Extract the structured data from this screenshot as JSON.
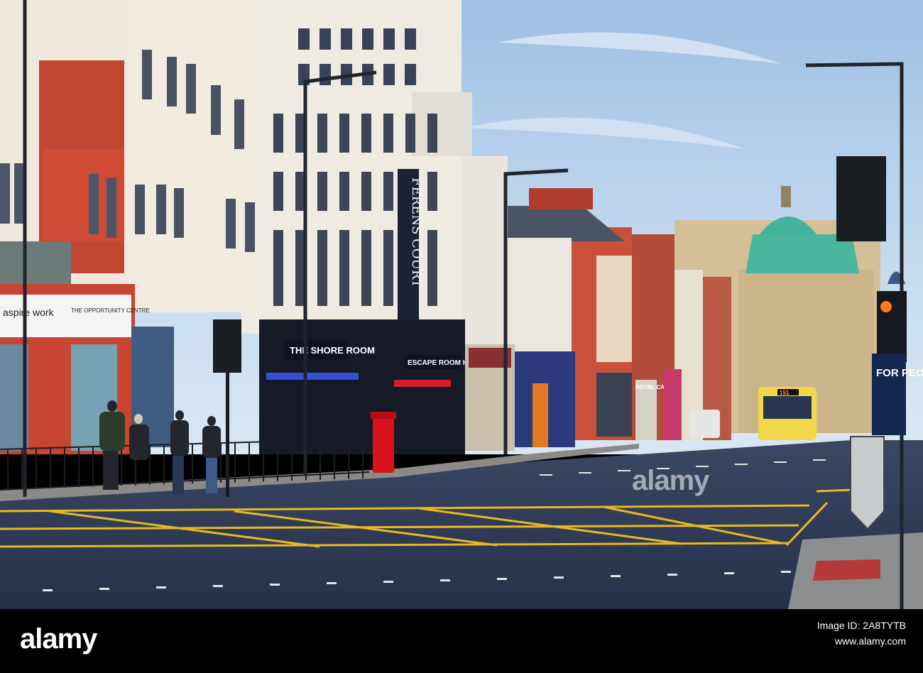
{
  "photo": {
    "signs": {
      "ferens_court": "FERENS COURT",
      "aspire_work": "aspire work",
      "opportunity_centre": "THE OPPORTUNITY CENTRE",
      "shore_room": "THE SHORE ROOM",
      "escape_room_hull": "ESCAPE ROOM HULL",
      "royal_cafe": "ROYAL CAFE",
      "bus_route": "151",
      "ad_panel": "FOR PEOP WHO LOV HUL"
    },
    "watermark": "alamy"
  },
  "footer": {
    "logo": "alamy",
    "image_id_line": "Image ID: 2A8TYTB",
    "url_line": "www.alamy.com"
  },
  "colors": {
    "sky": "#a9c6e6",
    "road": "#2d3a52",
    "road_marking": "#e8b722",
    "brick": "#c6432c",
    "dome": "#43b39a"
  }
}
